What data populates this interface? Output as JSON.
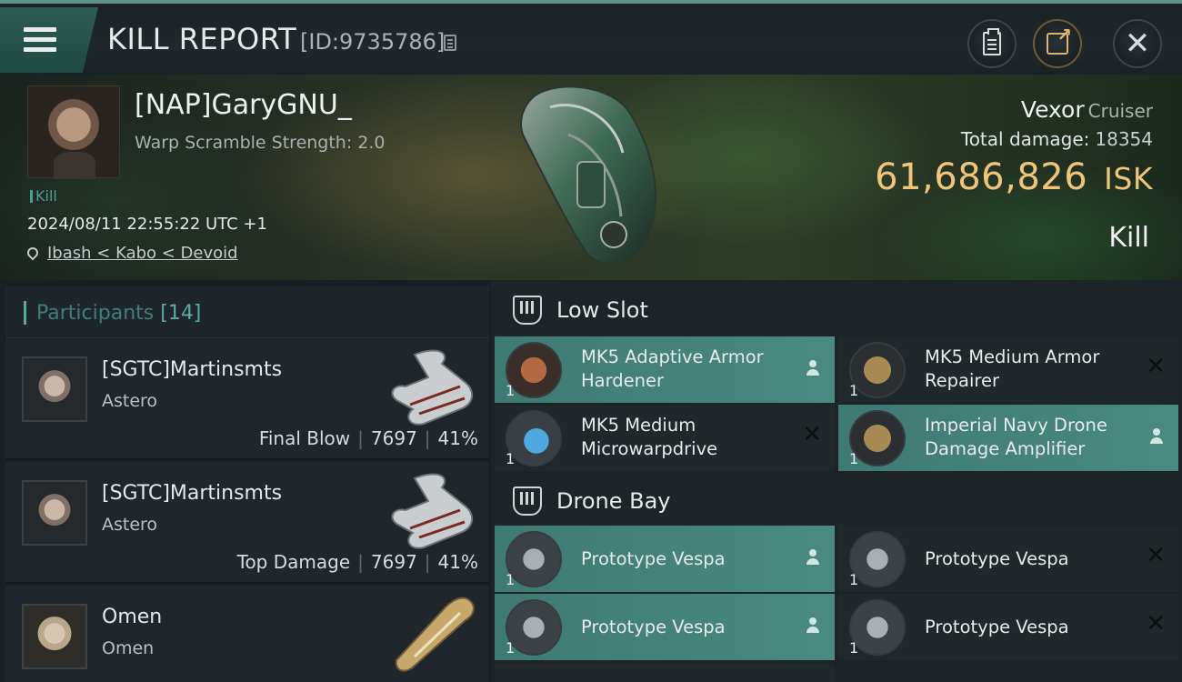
{
  "header": {
    "title": "KILL REPORT",
    "report_id": "[ID:9735786]"
  },
  "victim": {
    "name": "[NAP]GaryGNU_",
    "scramble": "Warp Scramble Strength: 2.0",
    "kill_tag": "Kill",
    "timestamp": "2024/08/11 22:55:22 UTC +1",
    "location": "Ibash < Kabo < Devoid",
    "ship_name": "Vexor",
    "ship_class": "Cruiser",
    "total_damage_label": "Total damage:",
    "total_damage": "18354",
    "isk_value": "61,686,826",
    "isk_unit": "ISK",
    "result": "Kill"
  },
  "participants": {
    "label": "Participants",
    "count": "[14]",
    "rows": [
      {
        "name": "[SGTC]Martinsmts",
        "ship": "Astero",
        "role": "Final Blow",
        "damage": "7697",
        "percent": "41%"
      },
      {
        "name": "[SGTC]Martinsmts",
        "ship": "Astero",
        "role": "Top Damage",
        "damage": "7697",
        "percent": "41%"
      },
      {
        "name": "Omen",
        "ship": "Omen",
        "role": "",
        "damage": "",
        "percent": ""
      }
    ]
  },
  "fitting": {
    "low_slot_title": "Low Slot",
    "drone_bay_title": "Drone Bay",
    "low_slots": [
      {
        "name": "MK5 Adaptive Armor Hardener",
        "qty": "1",
        "status": "dropped"
      },
      {
        "name": "MK5 Medium Armor Repairer",
        "qty": "1",
        "status": "destroyed"
      },
      {
        "name": "MK5 Medium Microwarpdrive",
        "qty": "1",
        "status": "destroyed"
      },
      {
        "name": "Imperial Navy Drone Damage Amplifier",
        "qty": "1",
        "status": "dropped"
      }
    ],
    "drones": [
      {
        "name": "Prototype  Vespa",
        "qty": "1",
        "status": "dropped"
      },
      {
        "name": "Prototype  Vespa",
        "qty": "1",
        "status": "destroyed"
      },
      {
        "name": "Prototype  Vespa",
        "qty": "1",
        "status": "dropped"
      },
      {
        "name": "Prototype  Vespa",
        "qty": "1",
        "status": "destroyed"
      }
    ]
  },
  "colors": {
    "accent": "#4a8a80",
    "isk": "#f0c57a"
  },
  "icons": [
    "menu-icon",
    "copy-icon",
    "clipboard-icon",
    "share-icon",
    "close-icon",
    "location-pin-icon",
    "shield-icon",
    "user-icon",
    "x-icon"
  ]
}
